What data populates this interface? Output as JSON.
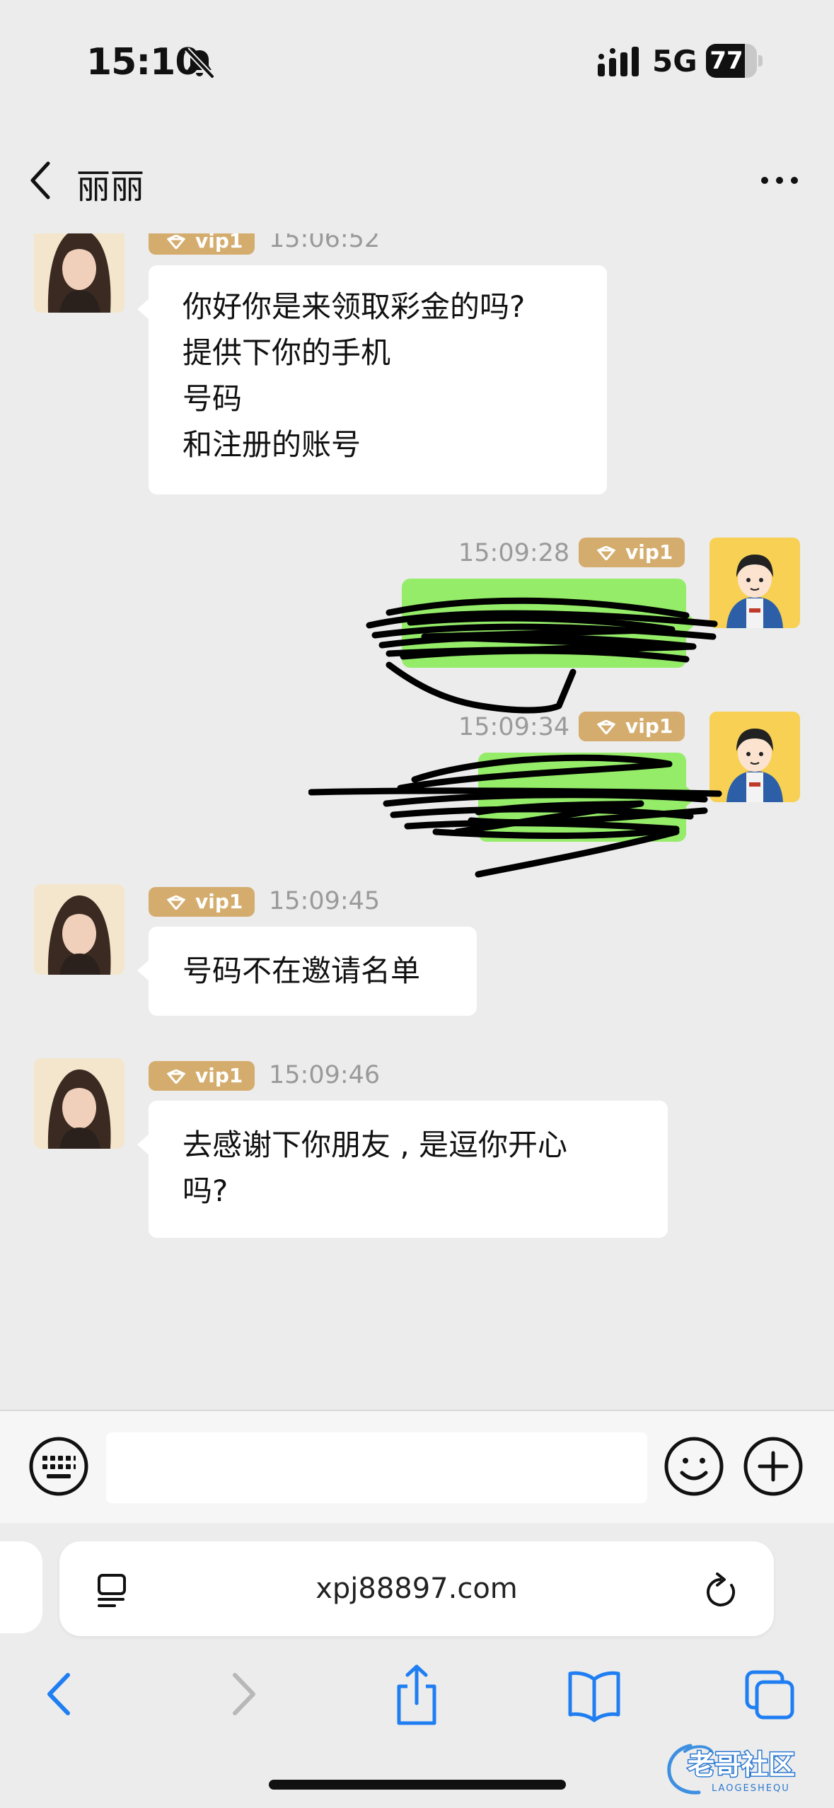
{
  "status_bar": {
    "time": "15:10",
    "network": "5G",
    "battery_level": "77",
    "battery_fraction": 0.77
  },
  "header": {
    "title": "丽丽"
  },
  "messages": [
    {
      "side": "in",
      "badge": "vip1",
      "time": "15:06:52",
      "lines": [
        "你好你是来领取彩金的吗?",
        "提供下你的手机",
        "号码",
        "和注册的账号"
      ]
    },
    {
      "side": "out",
      "badge": "vip1",
      "time": "15:09:28",
      "lines": []
    },
    {
      "side": "out",
      "badge": "vip1",
      "time": "15:09:34",
      "lines": []
    },
    {
      "side": "in",
      "badge": "vip1",
      "time": "15:09:45",
      "lines": [
        "号码不在邀请名单"
      ]
    },
    {
      "side": "in",
      "badge": "vip1",
      "time": "15:09:46",
      "lines": [
        "去感谢下你朋友 ,  是逗你开心",
        "吗?"
      ]
    }
  ],
  "input": {
    "value": "",
    "placeholder": ""
  },
  "safari": {
    "url": "xpj88897.com"
  },
  "watermark": {
    "text": "老哥社区",
    "sub": "LAOGESHEQU"
  },
  "colors": {
    "background": "#ececec",
    "outgoing_bubble": "#95ec69",
    "incoming_bubble": "#ffffff",
    "vip_badge": "#d4ad6e",
    "safari_blue": "#1f7ef2"
  }
}
